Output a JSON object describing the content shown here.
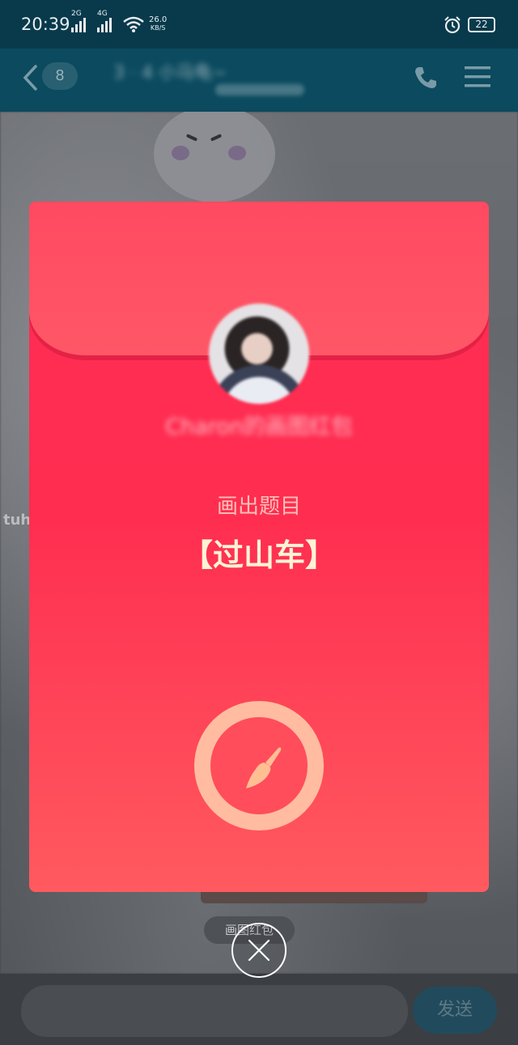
{
  "status_bar": {
    "time": "20:39",
    "signal1_tag": "2G",
    "signal2_tag": "4G",
    "net_speed_value": "26.0",
    "net_speed_unit": "KB/S",
    "battery": "22"
  },
  "chat_header": {
    "unread_count": "8",
    "contact_name": "3 · 4 小马龟~",
    "icons": [
      "back-icon",
      "phone-icon",
      "menu-icon"
    ]
  },
  "background": {
    "bottom_label": "画图红包"
  },
  "watermark": "tuhuaba.com",
  "red_packet": {
    "sender": "Charon的画图红包",
    "prompt_label": "画出题目",
    "subject": "【过山车】",
    "draw_icon": "brush-icon",
    "colors": {
      "packet_top": "#ff2d54",
      "packet_bottom": "#ff5a5f",
      "subject_text": "#fff3d6",
      "draw_ring": "#ffbca0"
    }
  },
  "close_icon": "close-icon",
  "input_bar": {
    "send_label": "发送",
    "placeholder": ""
  }
}
